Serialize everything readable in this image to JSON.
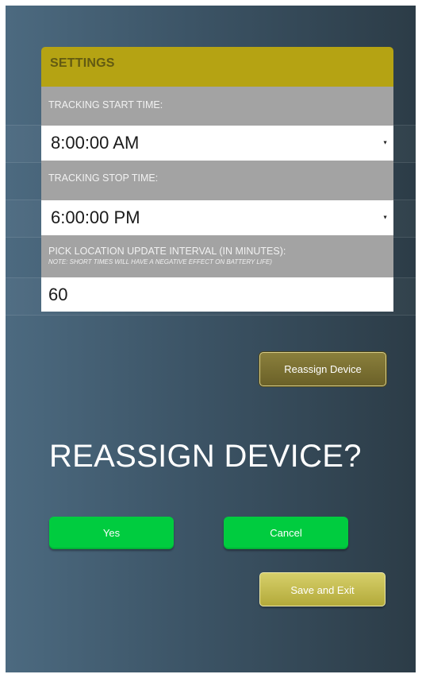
{
  "settings": {
    "title": "SETTINGS",
    "start_label": "TRACKING START TIME:",
    "start_value": "8:00:00 AM",
    "stop_label": "TRACKING STOP TIME:",
    "stop_value": "6:00:00 PM",
    "interval_label": "PICK LOCATION UPDATE INTERVAL (IN MINUTES):",
    "interval_note": "NOTE: SHORT TIMES WILL HAVE A NEGATIVE EFFECT ON BATTERY LIFE)",
    "interval_value": "60",
    "dropdown_arrow": "▼"
  },
  "actions": {
    "reassign_label": "Reassign Device",
    "prompt": "REASSIGN DEVICE?",
    "yes_label": "Yes",
    "cancel_label": "Cancel",
    "save_label": "Save and Exit"
  },
  "colors": {
    "header": "#b5a313",
    "header_text": "#625a12",
    "label_bg": "#a3a3a3",
    "confirm_green": "#00cc3f",
    "reassign_bg": "#7a6f32",
    "save_bg": "#c8c052",
    "background_left": "#4c6a80",
    "background_right": "#2c3c47"
  }
}
